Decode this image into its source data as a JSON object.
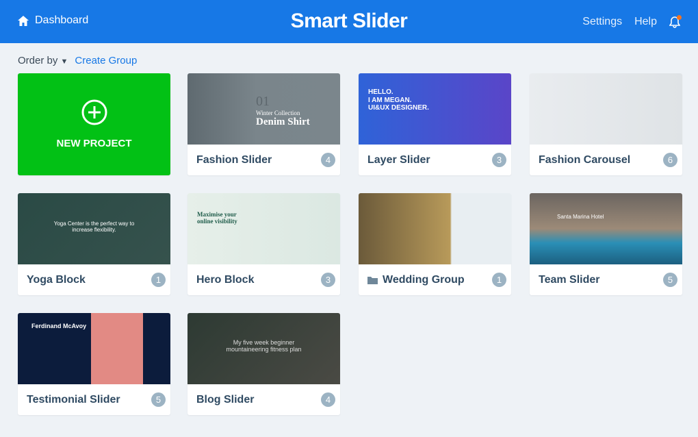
{
  "header": {
    "dashboard": "Dashboard",
    "logo": "Smart Slider",
    "settings": "Settings",
    "help": "Help",
    "notification_dot_color": "#f5731f",
    "brand_color": "#1778e6"
  },
  "toolbar": {
    "order_by": "Order by",
    "create_group": "Create Group"
  },
  "new_project": {
    "label": "NEW PROJECT",
    "color": "#02c115"
  },
  "cards": [
    {
      "title": "Fashion Slider",
      "count": "4",
      "thumb": {
        "line1": "01",
        "line2": "Winter Collection",
        "line3": "Denim Shirt"
      }
    },
    {
      "title": "Layer Slider",
      "count": "3",
      "thumb": {
        "line1": "HELLO.",
        "line2": "I AM MEGAN.",
        "line3": "UI&UX DESIGNER."
      }
    },
    {
      "title": "Fashion Carousel",
      "count": "6",
      "thumb": {}
    },
    {
      "title": "Yoga Block",
      "count": "1",
      "thumb": {
        "line1": "Yoga Center is the perfect way to",
        "line2": "increase flexibility."
      }
    },
    {
      "title": "Hero Block",
      "count": "3",
      "thumb": {
        "line1": "Maximise your",
        "line2": "online visibility"
      }
    },
    {
      "title": "Wedding Group",
      "count": "1",
      "is_group": true,
      "thumb": {}
    },
    {
      "title": "Team Slider",
      "count": "5",
      "thumb": {
        "line1": "Santa Marina Hotel"
      }
    },
    {
      "title": "Testimonial Slider",
      "count": "5",
      "thumb": {
        "line1": "Ferdinand McAvoy"
      }
    },
    {
      "title": "Blog Slider",
      "count": "4",
      "thumb": {
        "line1": "My five week beginner",
        "line2": "mountaineering fitness plan"
      }
    }
  ]
}
